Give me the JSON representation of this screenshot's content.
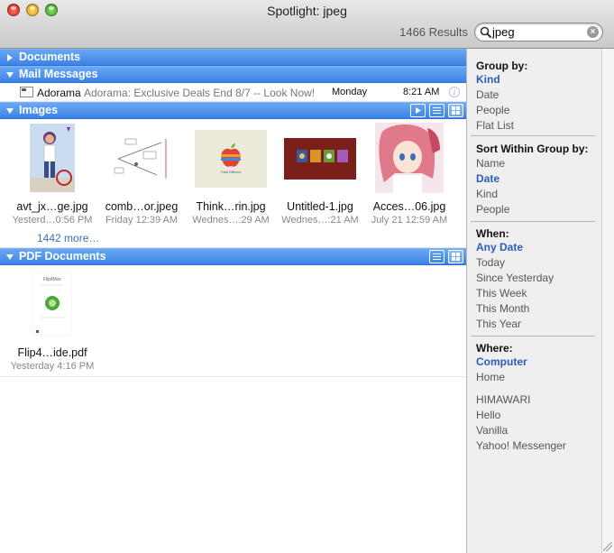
{
  "window": {
    "title": "Spotlight: jpeg",
    "results": "1466 Results"
  },
  "search": {
    "query": "jpeg"
  },
  "groups": {
    "documents": "Documents",
    "mail": "Mail Messages",
    "images": "Images",
    "pdf": "PDF Documents"
  },
  "mail": {
    "from": "Adorama",
    "subject": "Adorama: Exclusive Deals End 8/7 -- Look Now!",
    "day": "Monday",
    "time": "8:21 AM"
  },
  "images": [
    {
      "name": "avt_jx…ge.jpg",
      "date": "Yesterd…0:56 PM"
    },
    {
      "name": "comb…or.jpeg",
      "date": "Friday 12:39 AM"
    },
    {
      "name": "Think…rin.jpg",
      "date": "Wednes…:29 AM",
      "caption": "Think Different"
    },
    {
      "name": "Untitled-1.jpg",
      "date": "Wednes…:21 AM"
    },
    {
      "name": "Acces…06.jpg",
      "date": "July 21 12:59 AM"
    }
  ],
  "more": "1442 more…",
  "pdf": [
    {
      "name": "Flip4…ide.pdf",
      "date": "Yesterday 4:16 PM",
      "caption": "Flip4Mac"
    }
  ],
  "sidebar": {
    "group_by": {
      "title": "Group by:",
      "items": [
        "Kind",
        "Date",
        "People",
        "Flat List"
      ]
    },
    "sort": {
      "title": "Sort Within Group by:",
      "items": [
        "Name",
        "Date",
        "Kind",
        "People"
      ]
    },
    "when": {
      "title": "When:",
      "items": [
        "Any Date",
        "Today",
        "Since Yesterday",
        "This Week",
        "This Month",
        "This Year"
      ]
    },
    "where": {
      "title": "Where:",
      "items": [
        "Computer",
        "Home"
      ],
      "volumes": [
        "HIMAWARI",
        "Hello",
        "Vanilla",
        "Yahoo! Messenger"
      ]
    }
  },
  "colors": {
    "header_blue": "#3c83e6",
    "selected_link": "#2d5db8"
  }
}
